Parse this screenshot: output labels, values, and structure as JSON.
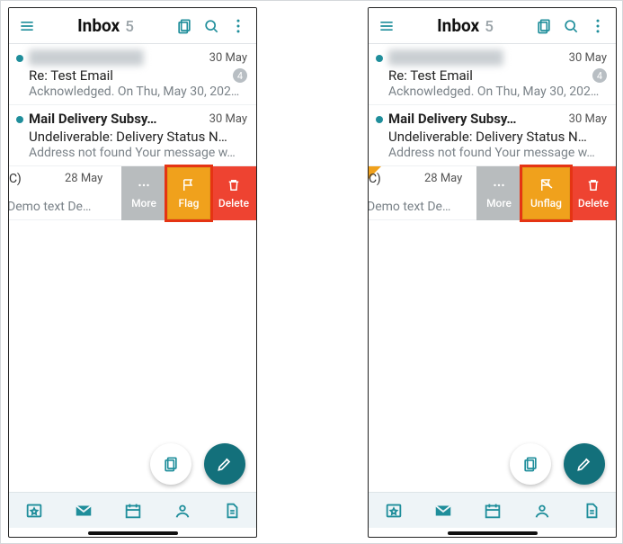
{
  "header": {
    "title": "Inbox",
    "count": "5"
  },
  "rows": [
    {
      "sender": "████████████",
      "date": "30 May",
      "subject": "Re: Test Email",
      "badge": "4",
      "preview": "Acknowledged. On Thu, May 30, 202…"
    },
    {
      "sender": "Mail Delivery Subsy…",
      "date": "30 May",
      "subject": "Undeliverable: Delivery Status N…",
      "preview": "Address not found Your message w…"
    }
  ],
  "swipe": {
    "paren": "C)",
    "date": "28 May",
    "preview": "Demo text De…"
  },
  "actions": {
    "more": "More",
    "flag": "Flag",
    "unflag": "Unflag",
    "delete": "Delete"
  },
  "colors": {
    "teal": "#1f8e9b",
    "teal_dark": "#13707b",
    "orange": "#f0a11c",
    "red": "#ee4331",
    "grey": "#b8bcbe"
  }
}
